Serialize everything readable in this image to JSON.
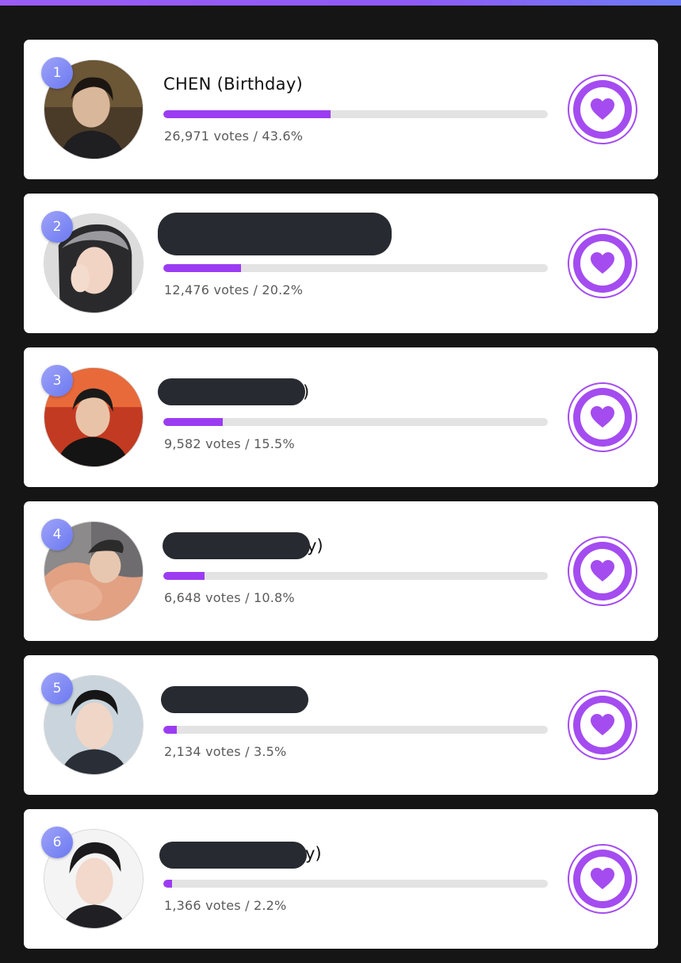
{
  "colors": {
    "accent": "#9b3cf2",
    "track": "#e3e3e3",
    "redaction": "#272a30",
    "rank_badge": "#7c86f4"
  },
  "entries": [
    {
      "rank": "1",
      "name": "CHEN (Birthday)",
      "name_tail": "",
      "votes_text": "26,971 votes / 43.6%",
      "percent": 43.6,
      "avatar_icon": "avatar-photo",
      "vote_icon": "heart-icon"
    },
    {
      "rank": "2",
      "name": "",
      "name_tail": "",
      "votes_text": "12,476 votes / 20.2%",
      "percent": 20.2,
      "avatar_icon": "avatar-photo",
      "vote_icon": "heart-icon"
    },
    {
      "rank": "3",
      "name": "",
      "name_tail": ")",
      "votes_text": "9,582 votes / 15.5%",
      "percent": 15.5,
      "avatar_icon": "avatar-photo",
      "vote_icon": "heart-icon"
    },
    {
      "rank": "4",
      "name": "",
      "name_tail": "y)",
      "votes_text": "6,648 votes / 10.8%",
      "percent": 10.8,
      "avatar_icon": "avatar-photo",
      "vote_icon": "heart-icon"
    },
    {
      "rank": "5",
      "name": "",
      "name_tail": "",
      "votes_text": "2,134 votes / 3.5%",
      "percent": 3.5,
      "avatar_icon": "avatar-photo",
      "vote_icon": "heart-icon"
    },
    {
      "rank": "6",
      "name": "",
      "name_tail": "y)",
      "votes_text": "1,366 votes / 2.2%",
      "percent": 2.2,
      "avatar_icon": "avatar-photo",
      "vote_icon": "heart-icon"
    }
  ]
}
